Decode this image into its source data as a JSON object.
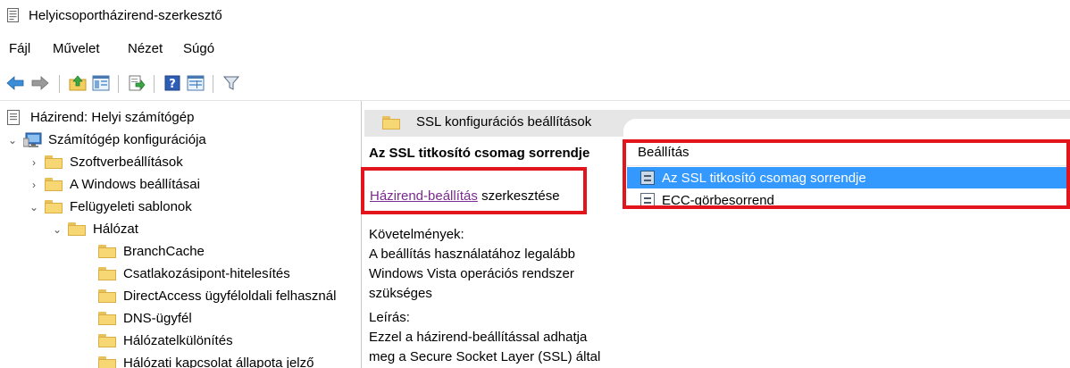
{
  "window": {
    "title": "Helyicsoportházirend-szerkesztő",
    "icon": "policy-editor-icon"
  },
  "menu": [
    {
      "label": "Fájl"
    },
    {
      "label": "Művelet"
    },
    {
      "label": "Nézet"
    },
    {
      "label": "Súgó"
    }
  ],
  "toolbar": {
    "icons": [
      "back-arrow-icon",
      "forward-arrow-icon",
      "up-folder-icon",
      "show-hide-tree-icon",
      "export-list-icon",
      "help-icon",
      "extended-view-icon",
      "filter-icon"
    ]
  },
  "tree": {
    "root": "Házirend: Helyi számítógép",
    "items": [
      {
        "label": "Számítógép konfigurációja",
        "state": "expanded"
      },
      {
        "label": "Szoftverbeállítások",
        "state": "collapsed"
      },
      {
        "label": "A Windows beállításai",
        "state": "collapsed"
      },
      {
        "label": "Felügyeleti sablonok",
        "state": "expanded"
      },
      {
        "label": "Hálózat",
        "state": "expanded"
      },
      {
        "label": "BranchCache"
      },
      {
        "label": "Csatlakozásipont-hitelesítés"
      },
      {
        "label": "DirectAccess ügyféloldali felhasznál"
      },
      {
        "label": "DNS-ügyfél"
      },
      {
        "label": "Hálózatelkülönítés"
      },
      {
        "label": "Hálózati kapcsolat állapota jelző"
      }
    ]
  },
  "right": {
    "header": "SSL konfigurációs beállítások",
    "setting_title": "Az SSL titkosító csomag sorrendje",
    "edit_link": "Házirend-beállítás",
    "edit_suffix": " szerkesztése",
    "requirements_label": "Követelmények:",
    "requirements_text": "A beállítás használatához legalább Windows Vista operációs rendszer szükséges",
    "description_label": "Leírás:",
    "description_text": "Ezzel a házirend-beállítással adhatja meg a Secure Socket Layer (SSL) által",
    "column_header": "Beállítás",
    "rows": [
      {
        "label": "Az SSL titkosító csomag sorrendje",
        "selected": true
      },
      {
        "label": "ECC-görbesorrend",
        "selected": false
      }
    ]
  },
  "colors": {
    "selection": "#3399ff",
    "highlight_box": "#e2141c",
    "link": "#7b2a8f",
    "header_bg": "#e6e6e6"
  }
}
